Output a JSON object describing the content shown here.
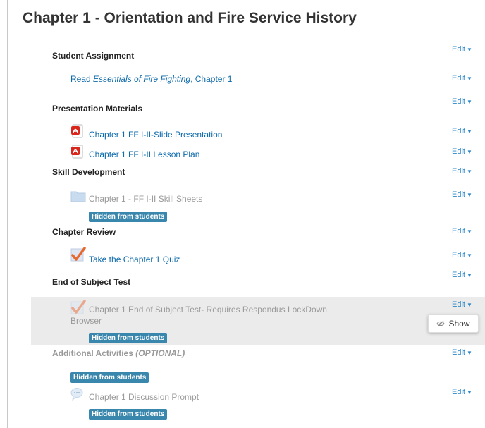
{
  "page_title": "Chapter 1 - Orientation and Fire Service History",
  "edit_label": "Edit",
  "hidden_label": "Hidden from students",
  "show_label": "Show",
  "sections": {
    "student_assignment": "Student Assignment",
    "presentation_materials": "Presentation Materials",
    "skill_development": "Skill Development",
    "chapter_review": "Chapter Review",
    "end_of_subject_test": "End of Subject Test",
    "additional_activities": "Additional Activities",
    "additional_activities_suffix": "(OPTIONAL)"
  },
  "items": {
    "read_prefix": "Read ",
    "read_book": "Essentials of Fire Fighting",
    "read_suffix": ", Chapter 1",
    "slide_presentation": "Chapter 1 FF I-II-Slide Presentation",
    "lesson_plan": "Chapter 1 FF I-II Lesson Plan",
    "skill_sheets": "Chapter 1 - FF I-II Skill Sheets",
    "quiz": "Take the Chapter 1 Quiz",
    "end_test_line1": "Chapter 1 End of Subject Test- Requires Respondus LockDown",
    "end_test_line2": "Browser",
    "discussion_prompt": "Chapter 1 Discussion Prompt"
  }
}
